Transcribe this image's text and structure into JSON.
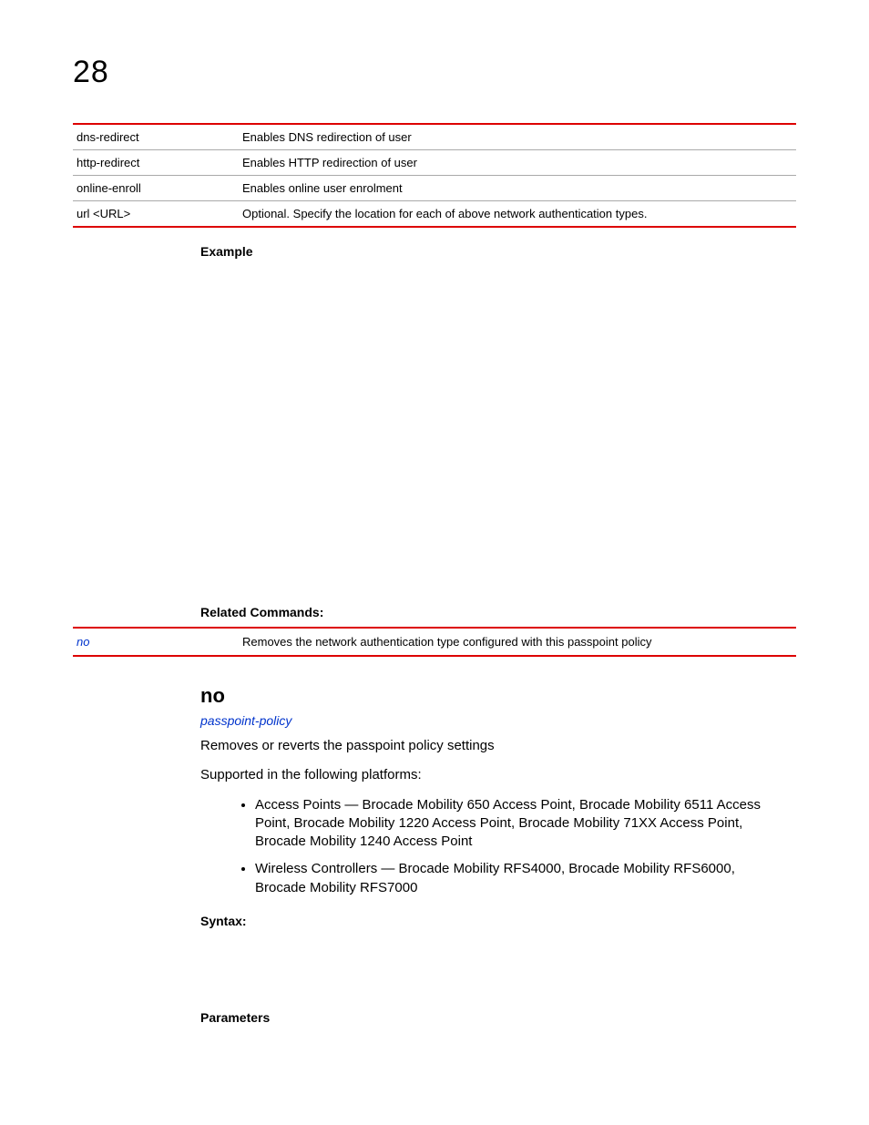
{
  "chapter_number": "28",
  "param_table": [
    {
      "name": "dns-redirect",
      "desc": "Enables DNS redirection of user"
    },
    {
      "name": "http-redirect",
      "desc": "Enables HTTP redirection of user"
    },
    {
      "name": "online-enroll",
      "desc": "Enables online user enrolment"
    },
    {
      "name": "url <URL>",
      "desc": "Optional. Specify the location for each of above network authentication types."
    }
  ],
  "labels": {
    "example": "Example",
    "related_commands": "Related Commands:",
    "syntax": "Syntax:",
    "parameters": "Parameters"
  },
  "related_table": {
    "cmd": "no",
    "desc": "Removes the network authentication type configured with this passpoint policy"
  },
  "section": {
    "heading": "no",
    "link": "passpoint-policy",
    "intro": "Removes or reverts the passpoint policy settings",
    "supported": "Supported in the following platforms:",
    "platforms": [
      "Access Points — Brocade Mobility 650 Access Point, Brocade Mobility 6511 Access Point, Brocade Mobility 1220 Access Point, Brocade Mobility 71XX Access Point, Brocade Mobility 1240 Access Point",
      "Wireless Controllers — Brocade Mobility RFS4000, Brocade Mobility RFS6000, Brocade Mobility RFS7000"
    ]
  }
}
